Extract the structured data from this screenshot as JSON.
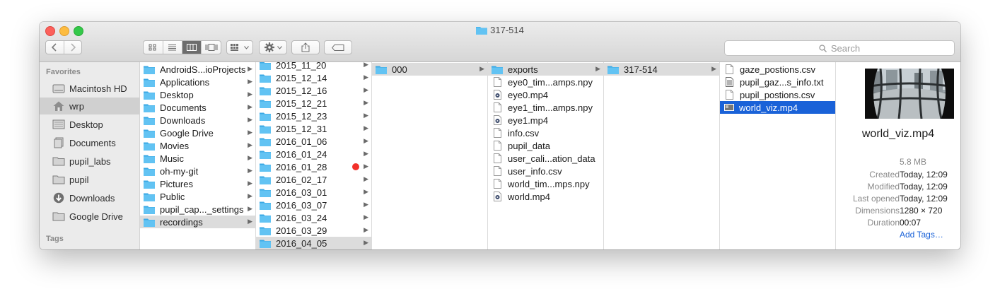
{
  "window": {
    "title": "317-514"
  },
  "search": {
    "placeholder": "Search"
  },
  "sidebar": {
    "favorites_header": "Favorites",
    "tags_header": "Tags",
    "items": [
      {
        "label": "Macintosh HD",
        "icon": "hard-drive-icon"
      },
      {
        "label": "wrp",
        "icon": "home-icon",
        "selected": true
      },
      {
        "label": "Desktop",
        "icon": "desktop-icon"
      },
      {
        "label": "Documents",
        "icon": "documents-icon"
      },
      {
        "label": "pupil_labs",
        "icon": "folder-icon"
      },
      {
        "label": "pupil",
        "icon": "folder-icon"
      },
      {
        "label": "Downloads",
        "icon": "downloads-icon"
      },
      {
        "label": "Google Drive",
        "icon": "folder-icon"
      }
    ]
  },
  "columns": {
    "col1": [
      "AndroidS...ioProjects",
      "Applications",
      "Desktop",
      "Documents",
      "Downloads",
      "Google Drive",
      "Movies",
      "Music",
      "oh-my-git",
      "Pictures",
      "Public",
      "pupil_cap..._settings",
      "recordings"
    ],
    "col2": [
      "2015_11_20",
      "2015_12_14",
      "2015_12_16",
      "2015_12_21",
      "2015_12_23",
      "2015_12_31",
      "2016_01_06",
      "2016_01_24",
      "2016_01_28",
      "2016_02_17",
      "2016_03_01",
      "2016_03_07",
      "2016_03_24",
      "2016_03_29",
      "2016_04_05"
    ],
    "col3": [
      "000"
    ],
    "col4": [
      "exports",
      "eye0_tim...amps.npy",
      "eye0.mp4",
      "eye1_tim...amps.npy",
      "eye1.mp4",
      "info.csv",
      "pupil_data",
      "user_cali...ation_data",
      "user_info.csv",
      "world_tim...mps.npy",
      "world.mp4"
    ],
    "col5": [
      "317-514"
    ],
    "col6": [
      "gaze_postions.csv",
      "pupil_gaz...s_info.txt",
      "pupil_postions.csv",
      "world_viz.mp4"
    ]
  },
  "preview": {
    "filename": "world_viz.mp4",
    "size": "5.8 MB",
    "meta": [
      {
        "key": "Created",
        "value": "Today, 12:09"
      },
      {
        "key": "Modified",
        "value": "Today, 12:09"
      },
      {
        "key": "Last opened",
        "value": "Today, 12:09"
      },
      {
        "key": "Dimensions",
        "value": "1280 × 720"
      },
      {
        "key": "Duration",
        "value": "00:07"
      }
    ],
    "add_tags": "Add Tags…"
  },
  "colors": {
    "folder": "#4fb9ee",
    "selection": "#1a62d8",
    "tag_red": "#f2302a"
  }
}
